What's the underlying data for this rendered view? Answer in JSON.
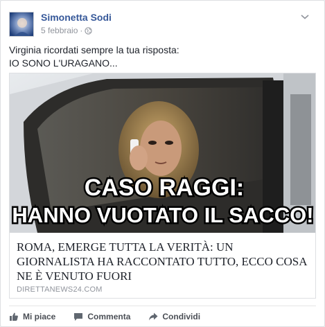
{
  "post": {
    "author": "Simonetta Sodi",
    "date": "5 febbraio",
    "separator": "·",
    "privacy_icon": "globe-icon",
    "text_lines": [
      "Virginia ricordati sempre la tua risposta:",
      "IO SONO L'URAGANO..."
    ]
  },
  "link": {
    "overlay_line1": "CASO RAGGI:",
    "overlay_line2": "HANNO VUOTATO IL SACCO!",
    "title_lines": [
      "ROMA, EMERGE TUTTA LA VERITÀ: UN",
      "GIORNALISTA HA RACCONTATO TUTTO, ECCO COSA",
      "NE È VENUTO FUORI"
    ],
    "domain": "DIRETTANEWS24.COM"
  },
  "actions": {
    "like": "Mi piace",
    "comment": "Commenta",
    "share": "Condividi"
  },
  "colors": {
    "author_link": "#365899",
    "meta_text": "#90949c",
    "action_text": "#4b4f56"
  }
}
